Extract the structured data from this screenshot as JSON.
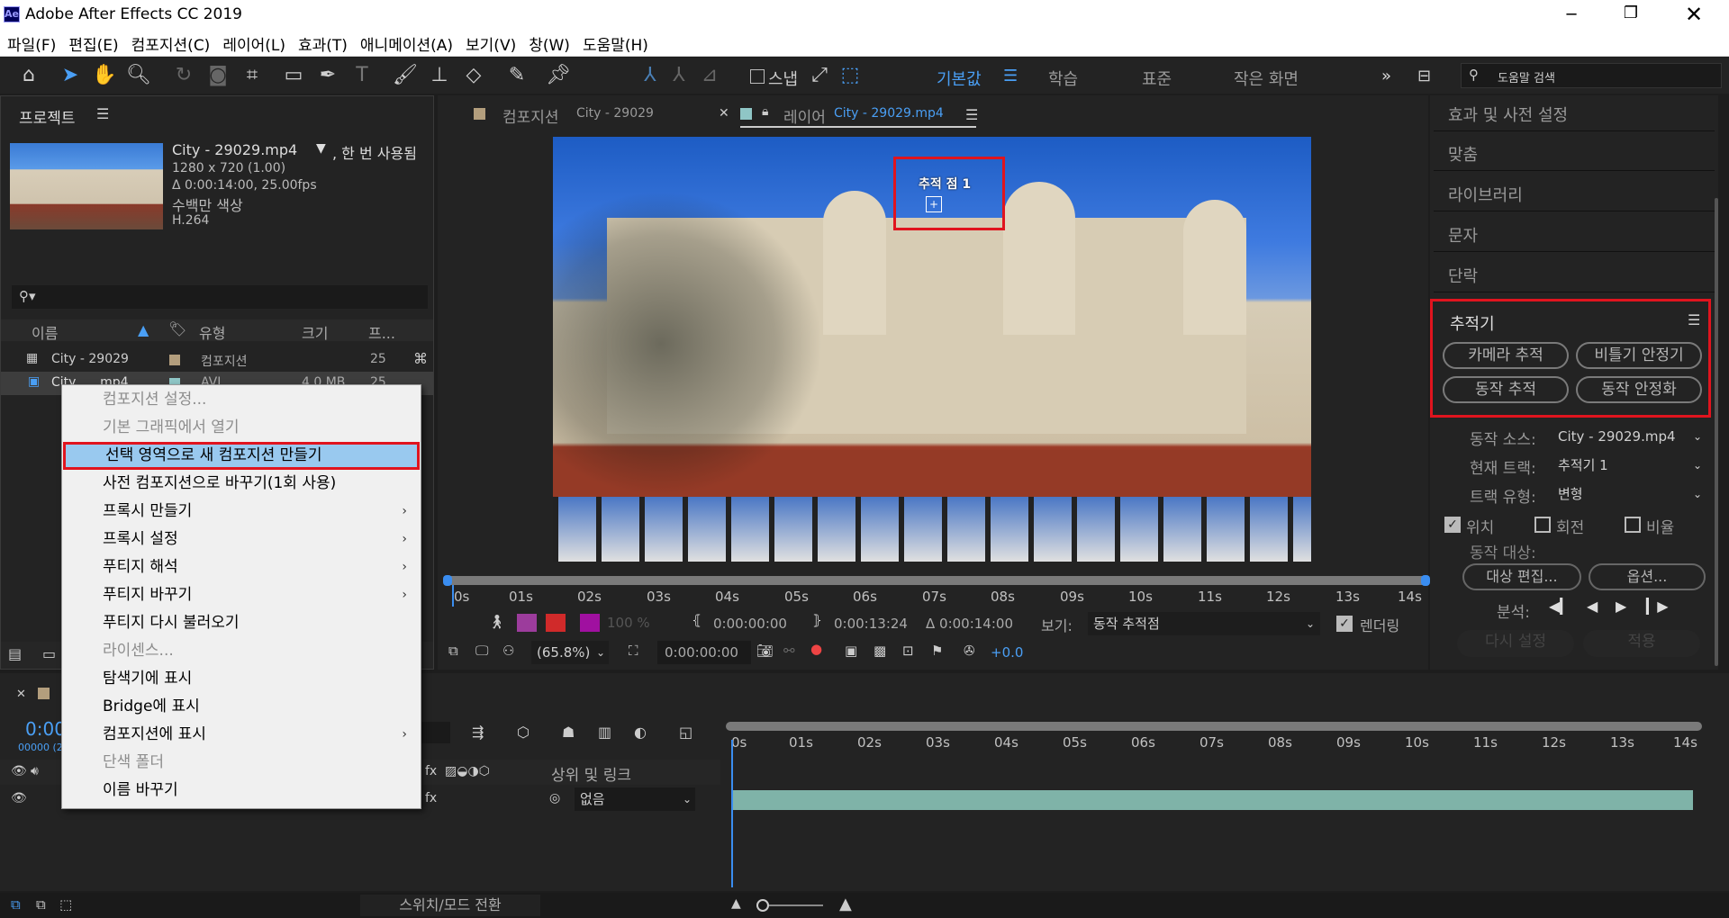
{
  "app": {
    "title": "Adobe After Effects CC 2019",
    "logo": "Ae"
  },
  "menu": [
    "파일(F)",
    "편집(E)",
    "컴포지션(C)",
    "레이어(L)",
    "효과(T)",
    "애니메이션(A)",
    "보기(V)",
    "창(W)",
    "도움말(H)"
  ],
  "toolbar": {
    "snap_label": "스냅",
    "workspaces": [
      "기본값",
      "학습",
      "표준",
      "작은 화면"
    ],
    "search_placeholder": "도움말 검색"
  },
  "project": {
    "title": "프로젝트",
    "item_name": "City - 29029.mp4",
    "used": ", 한 번 사용됨",
    "dims": "1280 x 720 (1.00)",
    "duration": "Δ 0:00:14:00, 25.00fps",
    "color": "수백만 색상",
    "codec": "H.264",
    "columns": {
      "name": "이름",
      "type": "유형",
      "size": "크기",
      "fps": "프..."
    },
    "rows": [
      {
        "name": "City - 29029",
        "type": "컴포지션",
        "size": "",
        "fps": "25"
      },
      {
        "name": "City ... .mp4",
        "type": "AVI",
        "size": "4.0 MB",
        "fps": "25"
      }
    ]
  },
  "context_menu": {
    "items": [
      {
        "label": "컴포지션 설정...",
        "disabled": true,
        "submenu": false
      },
      {
        "label": "기본 그래픽에서 열기",
        "disabled": true,
        "submenu": false
      },
      {
        "label": "선택 영역으로 새 컴포지션 만들기",
        "disabled": false,
        "submenu": false,
        "highlight": true
      },
      {
        "label": "사전 컴포지션으로 바꾸기(1회 사용)",
        "disabled": false,
        "submenu": false
      },
      {
        "label": "프록시 만들기",
        "disabled": false,
        "submenu": true
      },
      {
        "label": "프록시 설정",
        "disabled": false,
        "submenu": true
      },
      {
        "label": "푸티지 해석",
        "disabled": false,
        "submenu": true
      },
      {
        "label": "푸티지 바꾸기",
        "disabled": false,
        "submenu": true
      },
      {
        "label": "푸티지 다시 불러오기",
        "disabled": false,
        "submenu": false
      },
      {
        "label": "라이센스...",
        "disabled": true,
        "submenu": false
      },
      {
        "label": "탐색기에 표시",
        "disabled": false,
        "submenu": false
      },
      {
        "label": "Bridge에 표시",
        "disabled": false,
        "submenu": false
      },
      {
        "label": "컴포지션에 표시",
        "disabled": false,
        "submenu": true
      },
      {
        "label": "단색 폴더",
        "disabled": true,
        "submenu": false
      },
      {
        "label": "이름 바꾸기",
        "disabled": false,
        "submenu": false
      }
    ]
  },
  "viewer": {
    "tab_comp_prefix": "컴포지션",
    "tab_comp_name": "City - 29029",
    "tab_layer_prefix": "레이어",
    "tab_layer_name": "City - 29029.mp4",
    "track_point": "추적 점 1",
    "ruler_labels": [
      "0s",
      "01s",
      "02s",
      "03s",
      "04s",
      "05s",
      "06s",
      "07s",
      "08s",
      "09s",
      "10s",
      "11s",
      "12s",
      "13s",
      "14s"
    ],
    "opacity": "100 %",
    "in_time": "0:00:00:00",
    "out_time": "0:00:13:24",
    "dur_time": "Δ 0:00:14:00",
    "view_label": "보기:",
    "view_value": "동작 추적점",
    "render_label": "렌더링",
    "zoom": "(65.8%)",
    "current_time": "0:00:00:00",
    "exposure": "+0.0"
  },
  "right_panel": {
    "sections": [
      "효과 및 사전 설정",
      "맞춤",
      "라이브러리",
      "문자",
      "단락"
    ],
    "tracker": {
      "title": "추적기",
      "buttons": [
        "카메라 추적",
        "비틀기 안정기",
        "동작 추적",
        "동작 안정화"
      ],
      "source_label": "동작 소스:",
      "source_value": "City - 29029.mp4",
      "track_label": "현재 트랙:",
      "track_value": "추적기 1",
      "type_label": "트랙 유형:",
      "type_value": "변형",
      "checks": [
        {
          "label": "위치",
          "checked": true
        },
        {
          "label": "회전",
          "checked": false
        },
        {
          "label": "비율",
          "checked": false
        }
      ],
      "target_label": "동작 대상:",
      "edit_target": "대상 편집...",
      "options": "옵션...",
      "analyze_label": "분석:",
      "reset": "다시 설정",
      "apply": "적용"
    }
  },
  "timeline": {
    "time": "0:00",
    "frames": "00000 (2",
    "parent_header": "상위 및 링크",
    "parent_value": "없음",
    "ruler_labels": [
      "0s",
      "01s",
      "02s",
      "03s",
      "04s",
      "05s",
      "06s",
      "07s",
      "08s",
      "09s",
      "10s",
      "11s",
      "12s",
      "13s",
      "14s"
    ],
    "switch_label": "스위치/모드 전환"
  }
}
